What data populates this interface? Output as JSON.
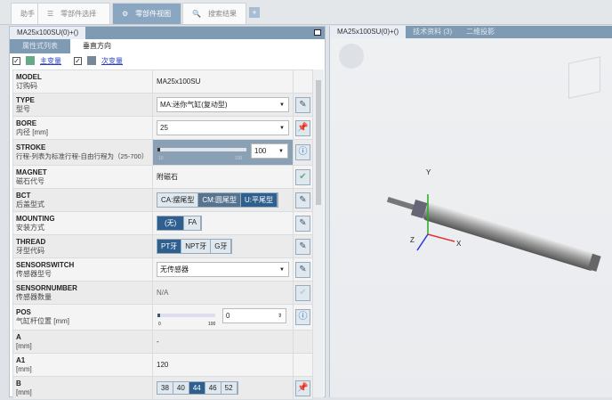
{
  "top_tabs": [
    {
      "label": "助手"
    },
    {
      "label": "零部件选择",
      "icon": "parts-icon"
    },
    {
      "label": "零部件视图",
      "icon": "view-icon"
    },
    {
      "label": "搜索结果",
      "icon": "search-icon"
    }
  ],
  "plus": "+",
  "left_panel": {
    "title": "MA25x100SU(0)+()",
    "subtabs": [
      "属性式列表",
      "垂直方向"
    ],
    "checks": [
      "主变量",
      "次变量"
    ]
  },
  "rows": [
    {
      "name": "MODEL",
      "desc": "订购码",
      "value": "MA25x100SU"
    },
    {
      "name": "TYPE",
      "desc": "型号",
      "value": "MA:迷你气缸(复动型)"
    },
    {
      "name": "BORE",
      "desc": "内径 [mm]",
      "value": "25"
    },
    {
      "name": "STROKE",
      "desc": "行程-列表为标准行程-自由行程为（25-700）",
      "value": "100",
      "slider_min": "10",
      "slider_max": "100"
    },
    {
      "name": "MAGNET",
      "desc": "磁石代号",
      "value": "附磁石"
    },
    {
      "name": "BCT",
      "desc": "后盖型式",
      "options": [
        "CA:摆尾型",
        "CM:圆尾型",
        "U:平尾型"
      ]
    },
    {
      "name": "MOUNTING",
      "desc": "安装方式",
      "options": [
        "(无)",
        "FA"
      ]
    },
    {
      "name": "THREAD",
      "desc": "牙型代码",
      "options": [
        "PT牙",
        "NPT牙",
        "G牙"
      ]
    },
    {
      "name": "SENSORSWITCH",
      "desc": "传感器型号",
      "value": "无传感器"
    },
    {
      "name": "SENSORNUMBER",
      "desc": "传感器数量",
      "value": "N/A"
    },
    {
      "name": "POS",
      "desc": "气缸杆位置 [mm]",
      "value": "0",
      "slider_min": "0",
      "slider_max": "100"
    },
    {
      "name": "A",
      "desc": "[mm]",
      "value": "-"
    },
    {
      "name": "A1",
      "desc": "[mm]",
      "value": "120"
    },
    {
      "name": "B",
      "desc": "[mm]",
      "options": [
        "38",
        "40",
        "44",
        "46",
        "52"
      ]
    }
  ],
  "right_panel": {
    "tabs": [
      "MA25x100SU(0)+()",
      "技术资料 (3)",
      "二维投影"
    ],
    "axes": [
      "Y",
      "X",
      "Z"
    ]
  }
}
